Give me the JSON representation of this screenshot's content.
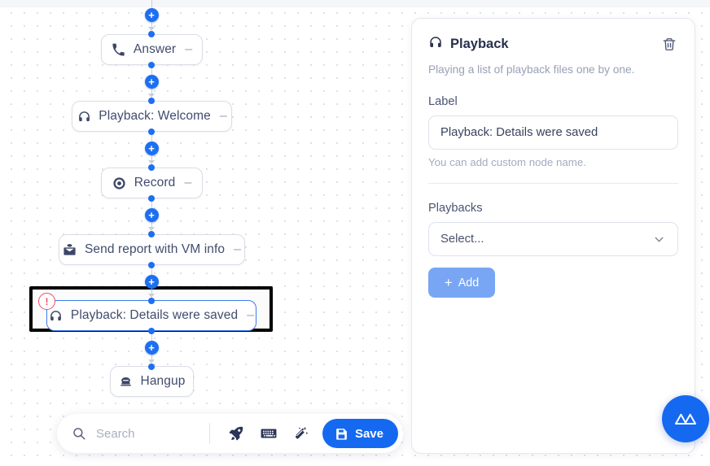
{
  "canvas": {
    "nodes": [
      {
        "id": "answer",
        "label": "Answer",
        "icon": "phone-handset-icon",
        "collapse": "–",
        "selected": false,
        "warning": false
      },
      {
        "id": "welcome",
        "label": "Playback: Welcome",
        "icon": "headphones-icon",
        "collapse": "–",
        "selected": false,
        "warning": false
      },
      {
        "id": "record",
        "label": "Record",
        "icon": "record-icon",
        "collapse": "–",
        "selected": false,
        "warning": false
      },
      {
        "id": "sendmail",
        "label": "Send report with VM info",
        "icon": "mail-envelope-icon",
        "collapse": "–",
        "selected": false,
        "warning": false
      },
      {
        "id": "details",
        "label": "Playback: Details were saved",
        "icon": "headphones-icon",
        "collapse": "–",
        "selected": true,
        "warning": true
      },
      {
        "id": "hangup",
        "label": "Hangup",
        "icon": "telephone-icon",
        "collapse": "",
        "selected": false,
        "warning": false
      }
    ],
    "add_node_label": "+",
    "warning_label": "!"
  },
  "panel": {
    "title": "Playback",
    "title_icon": "headphones-icon",
    "delete_icon": "trash-icon",
    "description": "Playing a list of playback files one by one.",
    "label_field": {
      "label": "Label",
      "value": "Playback: Details were saved",
      "placeholder": "Label",
      "hint": "You can add custom node name."
    },
    "playbacks": {
      "label": "Playbacks",
      "select_value": "Select...",
      "select_icon": "chevron-down-icon",
      "add_button": {
        "label": "Add",
        "icon": "plus-icon"
      }
    }
  },
  "toolbar": {
    "search_placeholder": "Search",
    "search_icon": "search-icon",
    "tools": [
      {
        "name": "rocket-icon"
      },
      {
        "name": "keyboard-icon"
      },
      {
        "name": "magic-wand-icon"
      }
    ],
    "save_label": "Save",
    "save_icon": "floppy-disk-save-icon"
  },
  "fab": {
    "icon": "brand-logo-icon"
  },
  "colors": {
    "accent_blue": "#1569f0",
    "port_blue": "#1d6ff2",
    "node_border": "#d9dde5",
    "selected_border": "#3e7bf0",
    "warning_red": "#ef4b63",
    "add_button_blue": "#78a6f4",
    "text_dark": "#28304d",
    "text_muted": "#98a0b7"
  }
}
